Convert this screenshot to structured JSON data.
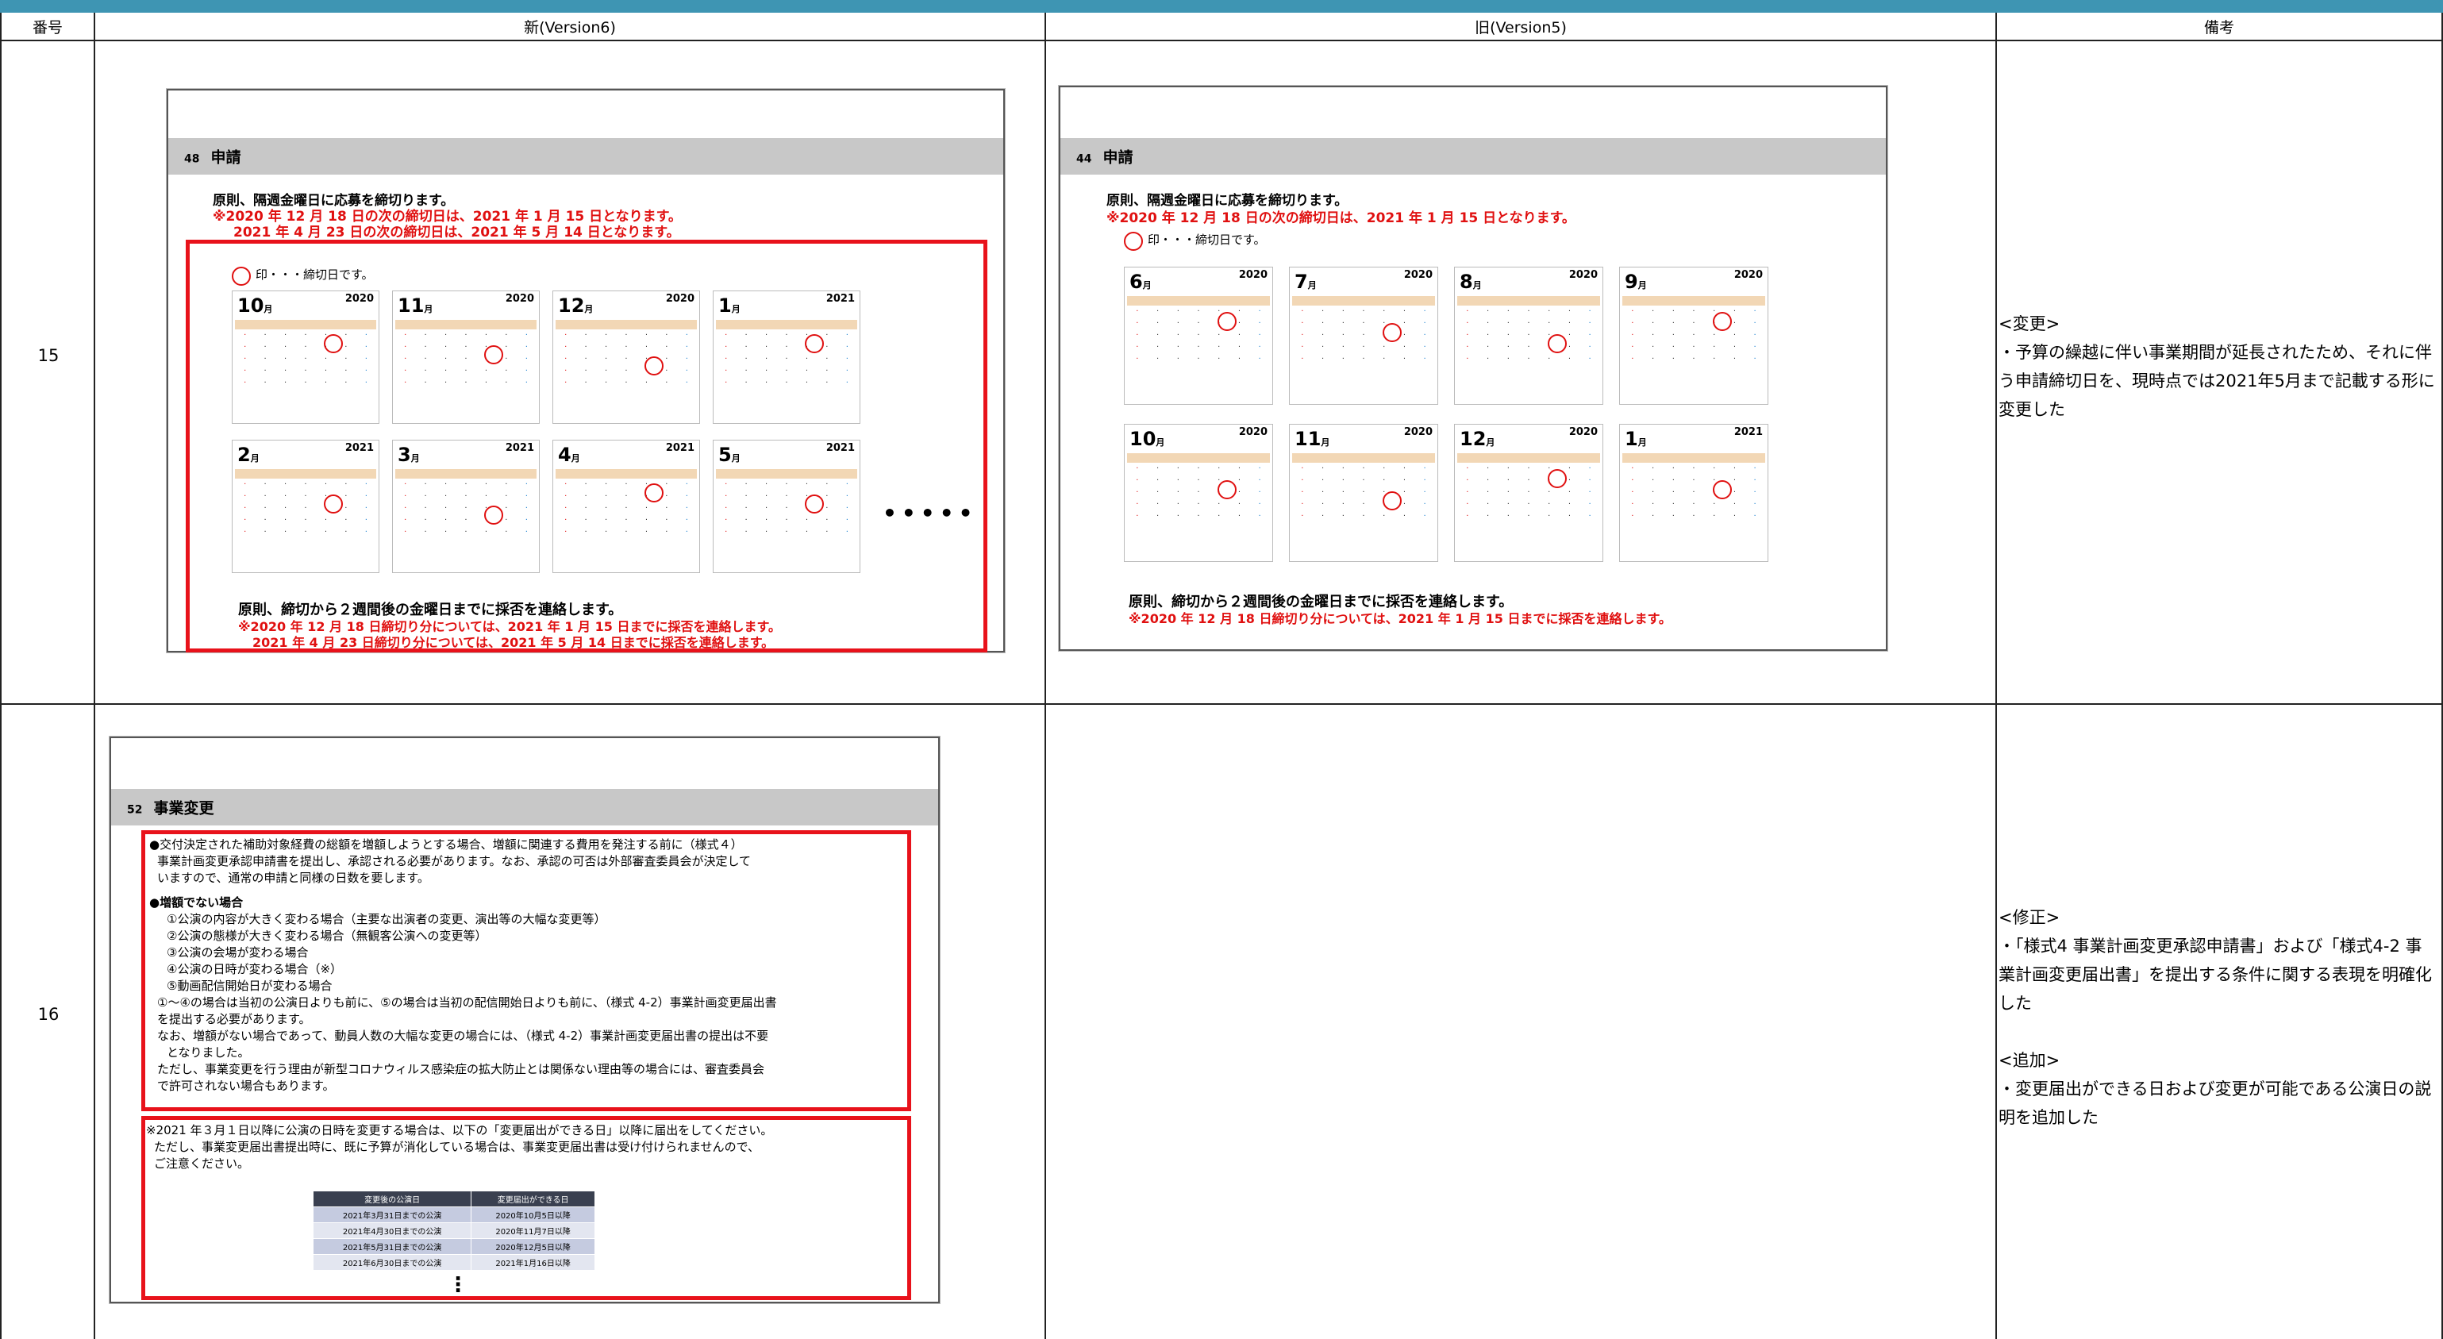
{
  "header": {
    "col_num": "番号",
    "col_new": "新(Version6)",
    "col_old": "旧(Version5)",
    "col_note": "備考"
  },
  "rows": [
    {
      "num": "15",
      "note": [
        "<変更>",
        "・予算の繰越に伴い事業期間が延長されたため、それに伴う申請締切日を、現時点では2021年5月まで記載する形に変更した"
      ]
    },
    {
      "num": "16",
      "note": [
        "<修正>",
        "・「様式4 事業計画変更承認申請書」および「様式4-2 事業計画変更届出書」を提出する条件に関する表現を明確化した",
        "",
        "<追加>",
        "・変更届出ができる日および変更が可能である公演日の説明を追加した"
      ]
    }
  ],
  "new15": {
    "sec_num": "48",
    "sec_title": "申請",
    "line1": "原則、隔週金曜日に応募を締切ります。",
    "line2": "※2020 年 12 月 18 日の次の締切日は、2021 年 1 月 15 日となります。",
    "line3": "2021 年 4 月 23 日の次の締切日は、2021 年 5 月 14 日となります。",
    "legend": "印・・・締切日です。",
    "footer1": "原則、締切から２週間後の金曜日までに採否を連絡します。",
    "footer2": "※2020 年 12 月 18 日締切り分については、2021 年 1 月 15 日までに採否を連絡します。",
    "footer3": "2021 年 4 月 23 日締切り分については、2021 年 5 月 14 日までに採否を連絡します。",
    "dots": "•••••",
    "months": [
      {
        "m": "10",
        "y": "2020"
      },
      {
        "m": "11",
        "y": "2020"
      },
      {
        "m": "12",
        "y": "2020"
      },
      {
        "m": "1",
        "y": "2021"
      },
      {
        "m": "2",
        "y": "2021"
      },
      {
        "m": "3",
        "y": "2021"
      },
      {
        "m": "4",
        "y": "2021"
      },
      {
        "m": "5",
        "y": "2021"
      }
    ]
  },
  "old15": {
    "sec_num": "44",
    "sec_title": "申請",
    "line1": "原則、隔週金曜日に応募を締切ります。",
    "line2": "※2020 年 12 月 18 日の次の締切日は、2021 年 1 月 15 日となります。",
    "legend": "印・・・締切日です。",
    "footer1": "原則、締切から２週間後の金曜日までに採否を連絡します。",
    "footer2": "※2020 年 12 月 18 日締切り分については、2021 年 1 月 15 日までに採否を連絡します。",
    "months": [
      {
        "m": "6",
        "y": "2020"
      },
      {
        "m": "7",
        "y": "2020"
      },
      {
        "m": "8",
        "y": "2020"
      },
      {
        "m": "9",
        "y": "2020"
      },
      {
        "m": "10",
        "y": "2020"
      },
      {
        "m": "11",
        "y": "2020"
      },
      {
        "m": "12",
        "y": "2020"
      },
      {
        "m": "1",
        "y": "2021"
      }
    ]
  },
  "new16": {
    "sec_num": "52",
    "sec_title": "事業変更",
    "p1": "●交付決定された補助対象経費の総額を増額しようとする場合、増額に関連する費用を発注する前に（様式４）",
    "p2": "事業計画変更承認申請書を提出し、承認される必要があります。なお、承認の可否は外部審査委員会が決定して",
    "p3": "いますので、通常の申請と同様の日数を要します。",
    "h2": "●増額でない場合",
    "items": [
      "①公演の内容が大きく変わる場合（主要な出演者の変更、演出等の大幅な変更等）",
      "②公演の態様が大きく変わる場合（無観客公演への変更等）",
      "③公演の会場が変わる場合",
      "④公演の日時が変わる場合（※）",
      "⑤動画配信開始日が変わる場合"
    ],
    "p4": "①～④の場合は当初の公演日よりも前に、⑤の場合は当初の配信開始日よりも前に、（様式 4-2）事業計画変更届出書",
    "p5": "を提出する必要があります。",
    "p6": "なお、増額がない場合であって、動員人数の大幅な変更の場合には、（様式 4-2）事業計画変更届出書の提出は不要",
    "p7": "となりました。",
    "p8": "ただし、事業変更を行う理由が新型コロナウィルス感染症の拡大防止とは関係ない理由等の場合には、審査委員会",
    "p9": "で許可されない場合もあります。",
    "n1": "※2021 年３月１日以降に公演の日時を変更する場合は、以下の「変更届出ができる日」以降に届出をしてください。",
    "n2": "ただし、事業変更届出書提出時に、既に予算が消化している場合は、事業変更届出書は受け付けられませんので、",
    "n3": "ご注意ください。",
    "table_head": [
      "変更後の公演日",
      "変更届出ができる日"
    ],
    "table_rows": [
      [
        "2021年3月31日までの公演",
        "2020年10月5日以降"
      ],
      [
        "2021年4月30日までの公演",
        "2020年11月7日以降"
      ],
      [
        "2021年5月31日までの公演",
        "2020年12月5日以降"
      ],
      [
        "2021年6月30日までの公演",
        "2021年1月16日以降"
      ]
    ],
    "vdots": "⋮"
  }
}
